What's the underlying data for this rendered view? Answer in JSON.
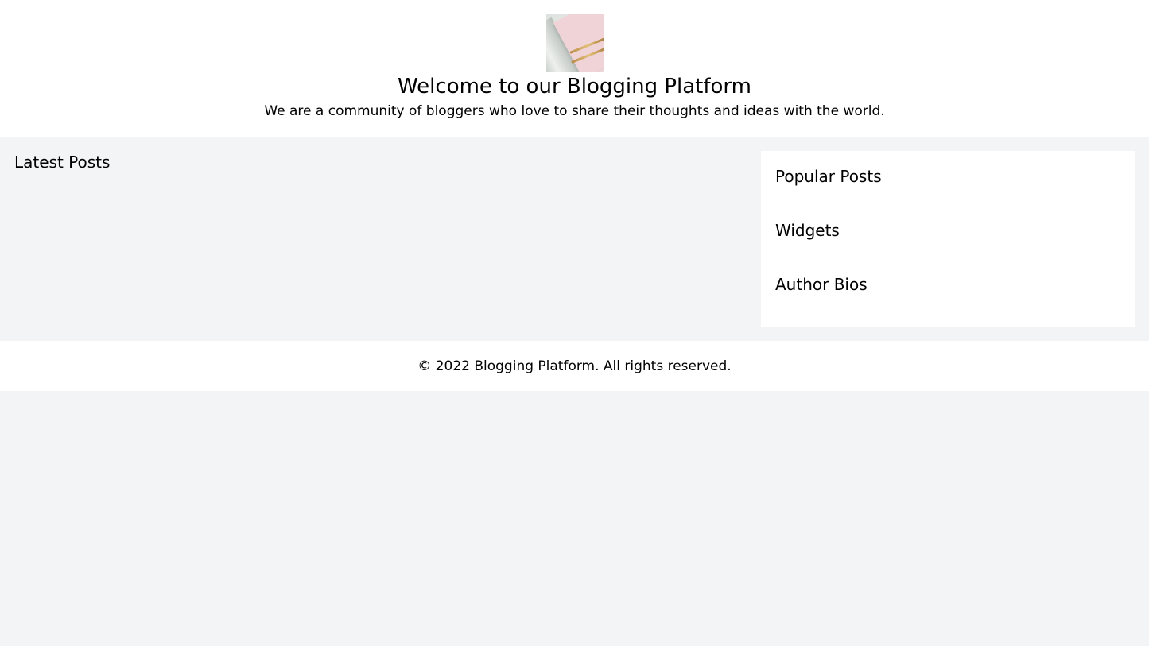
{
  "header": {
    "logo_icon": "notebook-with-pens-image",
    "title": "Welcome to our Blogging Platform",
    "tagline": "We are a community of bloggers who love to share their thoughts and ideas with the world."
  },
  "main": {
    "latest_posts_heading": "Latest Posts"
  },
  "sidebar": {
    "sections": [
      {
        "heading": "Popular Posts"
      },
      {
        "heading": "Widgets"
      },
      {
        "heading": "Author Bios"
      }
    ]
  },
  "footer": {
    "copyright": "© 2022 Blogging Platform. All rights reserved."
  },
  "colors": {
    "page_background": "#f3f4f6",
    "panel_background": "#ffffff",
    "text": "#000000"
  }
}
